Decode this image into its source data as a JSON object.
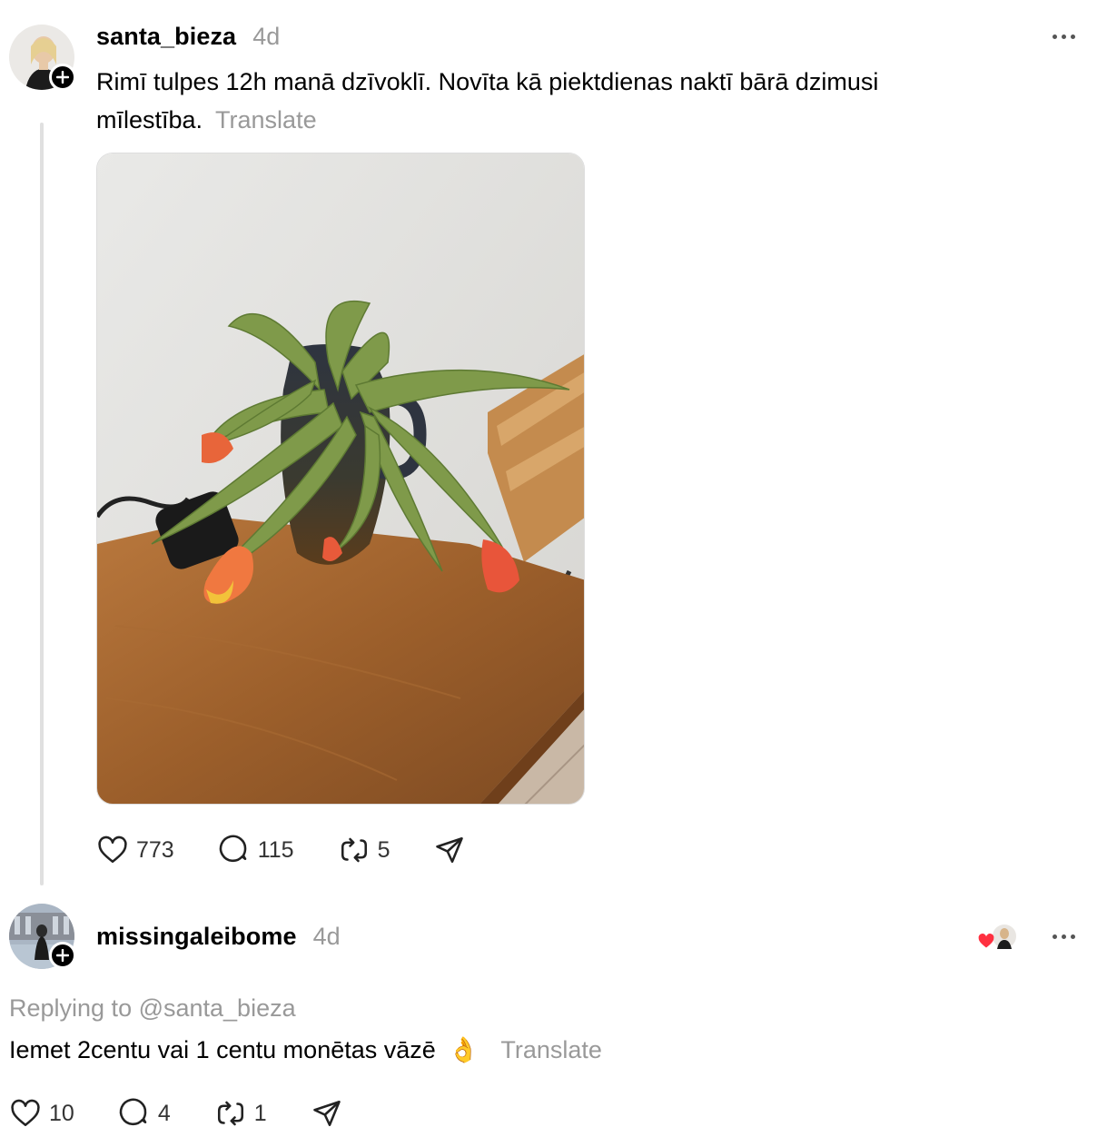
{
  "post": {
    "username": "santa_bieza",
    "time": "4d",
    "text": "Rimī tulpes 12h manā dzīvoklī. Novīta kā piektdienas naktī bārā dzimusi mīlestība.",
    "translate": "Translate",
    "stats": {
      "likes": "773",
      "comments": "115",
      "reposts": "5"
    }
  },
  "reply": {
    "username": "missingaleibome",
    "time": "4d",
    "replying_to": "Replying to @santa_bieza",
    "text": "Iemet 2centu vai 1 centu monētas vāzē",
    "emoji": "👌",
    "translate": "Translate",
    "stats": {
      "likes": "10",
      "comments": "4",
      "reposts": "1"
    }
  },
  "colors": {
    "accent_heart": "#ff3040",
    "muted": "#999999",
    "line": "#e0e0e0"
  },
  "icons": [
    "plus-icon",
    "more-icon",
    "heart-icon",
    "comment-icon",
    "repost-icon",
    "share-icon"
  ]
}
